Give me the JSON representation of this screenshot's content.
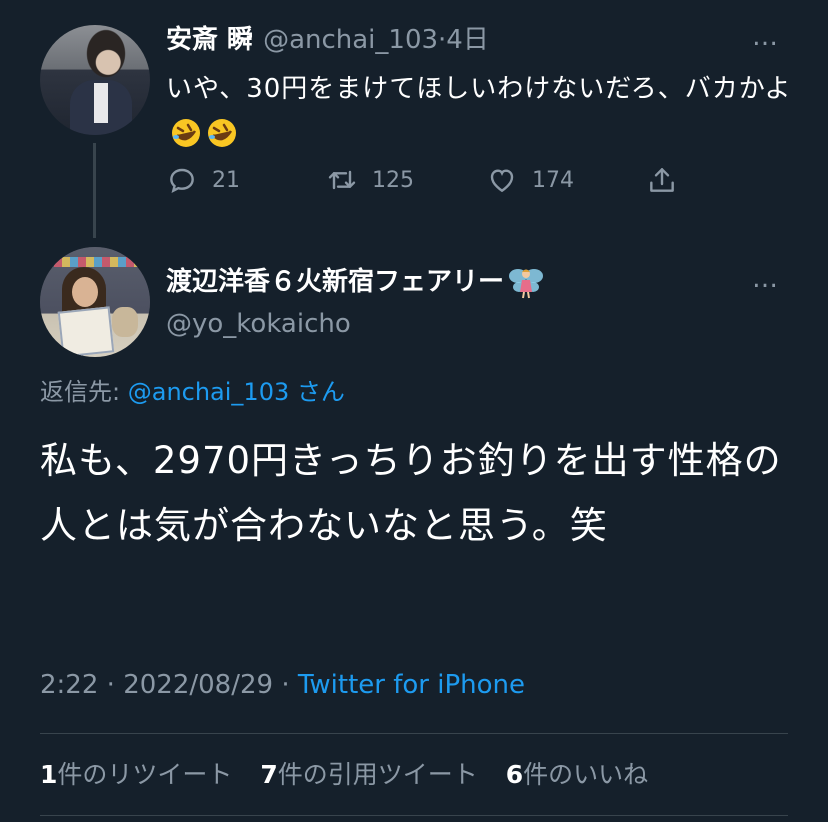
{
  "parent_tweet": {
    "display_name": "安斎 瞬",
    "handle": "@anchai_103",
    "time_sep": "·",
    "time": "4日",
    "text": "いや、30円をまけてほしいわけないだろ、バカかよ",
    "emoji": [
      "rolling-on-floor-laughing-emoji",
      "rolling-on-floor-laughing-emoji"
    ],
    "more_icon": "…",
    "actions": {
      "reply_count": "21",
      "retweet_count": "125",
      "like_count": "174"
    }
  },
  "main_tweet": {
    "display_name": "渡辺洋香６火新宿フェアリー",
    "name_emoji": "fairy-emoji",
    "handle": "@yo_kokaicho",
    "more_icon": "…",
    "reply_prefix": "返信先:",
    "reply_handle": "@anchai_103",
    "reply_suffix": "さん",
    "text": "私も、2970円きっちりお釣りを出す性格の人とは気が合わないなと思う。笑",
    "time": "2:22",
    "sep1": "·",
    "date": "2022/08/29",
    "sep2": "·",
    "source": "Twitter for iPhone"
  },
  "stats": {
    "retweets_count": "1",
    "retweets_label": "件のリツイート",
    "quotes_count": "7",
    "quotes_label": "件の引用ツイート",
    "likes_count": "6",
    "likes_label": "件のいいね"
  },
  "colors": {
    "background": "#15202b",
    "text": "#ffffff",
    "muted": "#8b98a5",
    "link": "#1d9bf0",
    "divider": "#38444d"
  }
}
